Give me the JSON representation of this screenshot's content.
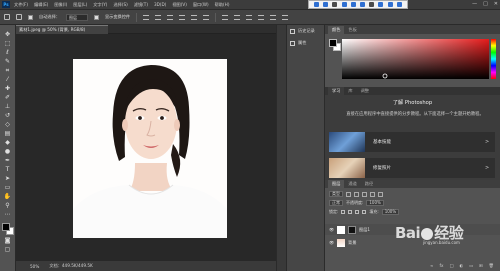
{
  "menubar": {
    "app_badge": "Ps",
    "items": [
      "文件(F)",
      "编辑(E)",
      "图像(I)",
      "图层(L)",
      "文字(Y)",
      "选择(S)",
      "滤镜(T)",
      "3D(D)",
      "视图(V)",
      "窗口(W)",
      "帮助(H)"
    ],
    "window_controls": [
      "—",
      "□",
      "✕"
    ]
  },
  "options": {
    "auto_select_label": "自动选择：",
    "auto_select_value": "图层",
    "transform_label": "显示变换控件"
  },
  "document": {
    "tab_title": "素材1.jpeg @ 50% (背景, RGB/8)",
    "zoom": "50%",
    "doc_info": "文档：449.5K/449.5K"
  },
  "history": {
    "items": [
      "历史记录",
      "属性"
    ]
  },
  "color_panel": {
    "tabs": [
      "颜色",
      "色板"
    ],
    "fg_color": "#000000",
    "bg_color": "#ffffff"
  },
  "learn_panel": {
    "tabs": [
      "学习",
      "库",
      "调整"
    ],
    "title": "了解 Photoshop",
    "desc": "直接在应用程序中直接提供的分步教程。从下面选择一个主题开始教程。",
    "cards": [
      {
        "label": "基本技能",
        "chevron": ">"
      },
      {
        "label": "修复照片",
        "chevron": ">"
      }
    ]
  },
  "layers_panel": {
    "tabs": [
      "图层",
      "通道",
      "路径"
    ],
    "filter_label": "类型",
    "blend_mode": "正常",
    "opacity_label": "不透明度:",
    "opacity": "100%",
    "lock_label": "锁定:",
    "fill_label": "填充:",
    "fill": "100%",
    "layers": [
      {
        "name": "图层1",
        "visible": true
      },
      {
        "name": "背景",
        "visible": true
      }
    ],
    "bottom_icons": [
      "fx",
      "□",
      "◐",
      "▭",
      "⊞",
      "🗑"
    ]
  },
  "watermark": {
    "text": "Bai",
    "text2": "经验",
    "url": "jingyan.baidu.com"
  }
}
